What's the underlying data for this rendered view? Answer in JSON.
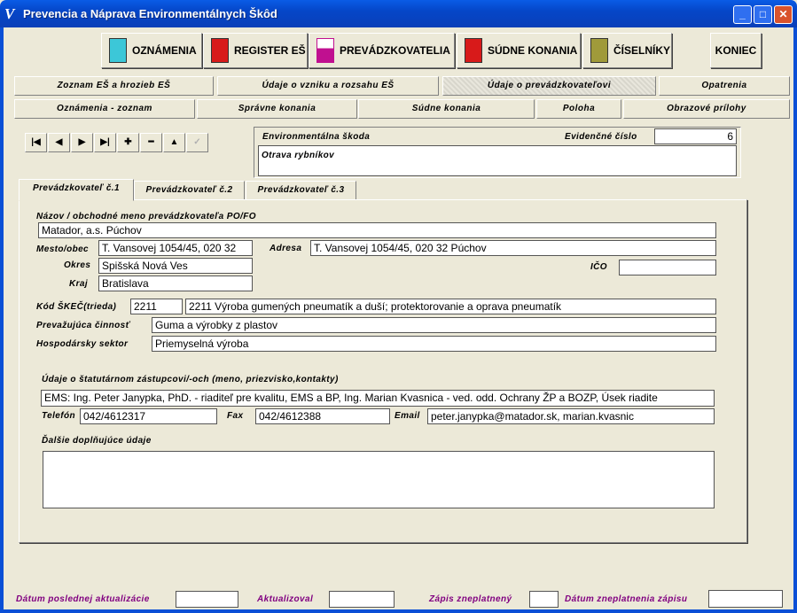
{
  "window": {
    "title": "Prevencia a Náprava Environmentálnych Škôd",
    "app_icon": "V",
    "minimize": "_",
    "maximize": "□",
    "close": "✕"
  },
  "toolbar": {
    "oznamenia": "OZNÁMENIA",
    "register": "REGISTER EŠ",
    "prevadzkovatelia": "PREVÁDZKOVATELIA",
    "sudne_konania": "SÚDNE KONANIA",
    "ciselniky": "ČÍSELNÍKY",
    "koniec": "KONIEC"
  },
  "tabs_row1": [
    "Zoznam EŠ a hrozieb EŠ",
    "Údaje o vzniku a rozsahu EŠ",
    "Údaje o prevádzkovateľovi",
    "Opatrenia"
  ],
  "tabs_row2": [
    "Oznámenia - zoznam",
    "Správne konania",
    "Súdne konania",
    "Poloha",
    "Obrazové prílohy"
  ],
  "nav": {
    "first": "|◀",
    "prev": "◀",
    "next": "▶",
    "last": "▶|",
    "add": "✚",
    "delete": "━",
    "up": "▲",
    "save": "✓"
  },
  "header": {
    "env_skoda_label": "Environmentálna škoda",
    "evid_label": "Evidenčné číslo",
    "evid_value": "6",
    "env_skoda_value": "Otrava rybníkov"
  },
  "operator_tabs": [
    "Prevádzkovateľ č.1",
    "Prevádzkovateľ č.2",
    "Prevádzkovateľ č.3"
  ],
  "form": {
    "nazov_label": "Názov / obchodné meno prevádzkovateľa PO/FO",
    "nazov_value": "Matador, a.s. Púchov",
    "mesto_label": "Mesto/obec",
    "mesto_value": "T. Vansovej 1054/45,  020 32",
    "adresa_label": "Adresa",
    "adresa_value": "T. Vansovej 1054/45,  020 32 Púchov",
    "okres_label": "Okres",
    "okres_value": "Spišská Nová Ves",
    "ico_label": "IČO",
    "ico_value": "",
    "kraj_label": "Kraj",
    "kraj_value": "Bratislava",
    "skec_label": "Kód ŠKEČ(trieda)",
    "skec_code": "2211",
    "skec_desc": "2211 Výroba gumených pneumatík a duší; protektorovanie a oprava pneumatík",
    "cinnost_label": "Prevažujúca činnosť",
    "cinnost_value": "Guma a výrobky z plastov",
    "sektor_label": "Hospodársky sektor",
    "sektor_value": "Priemyselná výroba",
    "statutar_label": "Údaje o štatutárnom zástupcovi/-och (meno, priezvisko,kontakty)",
    "statutar_value": "EMS: Ing. Peter Janypka, PhD. - riaditeľ pre kvalitu, EMS a BP,    Ing. Marian Kvasnica - ved. odd. Ochrany ŽP a BOZP, Úsek riadite",
    "telefon_label": "Telefón",
    "telefon_value": "042/4612317",
    "fax_label": "Fax",
    "fax_value": "042/4612388",
    "email_label": "Email",
    "email_value": "peter.janypka@matador.sk, marian.kvasnic",
    "dalsie_label": "Ďalšie doplňujúce údaje",
    "dalsie_value": ""
  },
  "footer": {
    "datum_akt_label": "Dátum poslednej aktualizácie",
    "datum_akt_value": "",
    "aktualizoval_label": "Aktualizoval",
    "aktualizoval_value": "",
    "zapis_label": "Zápis zneplatnený",
    "zapis_value": "",
    "datum_zneplat_label": "Dátum zneplatnenia zápisu",
    "datum_zneplat_value": ""
  },
  "colors": {
    "title_bar": "#0546c8",
    "footer_label": "#800080",
    "window_bg": "#ece9d8"
  }
}
